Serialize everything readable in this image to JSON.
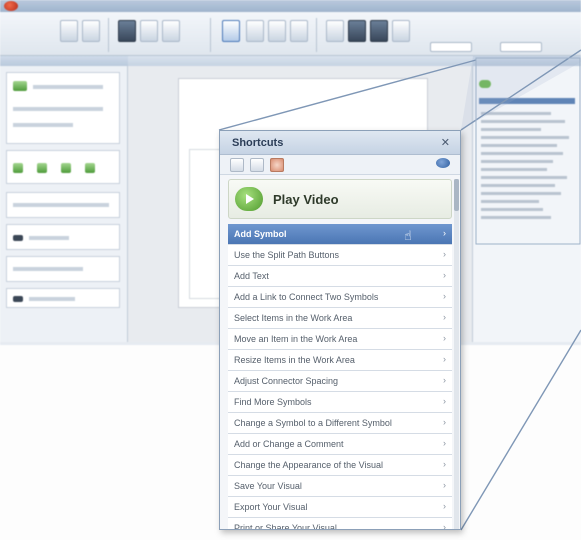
{
  "panel": {
    "title": "Shortcuts",
    "close_glyph": "✕",
    "primary": {
      "label": "Play Video",
      "icon": "play-video-icon"
    },
    "items": [
      {
        "label": "Add Symbol",
        "active": true
      },
      {
        "label": "Use the Split Path Buttons",
        "active": false
      },
      {
        "label": "Add Text",
        "active": false
      },
      {
        "label": "Add a Link to Connect Two Symbols",
        "active": false
      },
      {
        "label": "Select Items in the Work Area",
        "active": false
      },
      {
        "label": "Move an Item in the Work Area",
        "active": false
      },
      {
        "label": "Resize Items in the Work Area",
        "active": false
      },
      {
        "label": "Adjust Connector Spacing",
        "active": false
      },
      {
        "label": "Find More Symbols",
        "active": false
      },
      {
        "label": "Change a Symbol to a Different Symbol",
        "active": false
      },
      {
        "label": "Add or Change a Comment",
        "active": false
      },
      {
        "label": "Change the Appearance of the Visual",
        "active": false
      },
      {
        "label": "Save Your Visual",
        "active": false
      },
      {
        "label": "Export Your Visual",
        "active": false
      },
      {
        "label": "Print or Share Your Visual",
        "active": false
      }
    ],
    "chevron_glyph": "›"
  },
  "colors": {
    "accent_selected": "#4b76b4",
    "play_green": "#4f9a2d",
    "app_logo": "#b52a1a"
  }
}
